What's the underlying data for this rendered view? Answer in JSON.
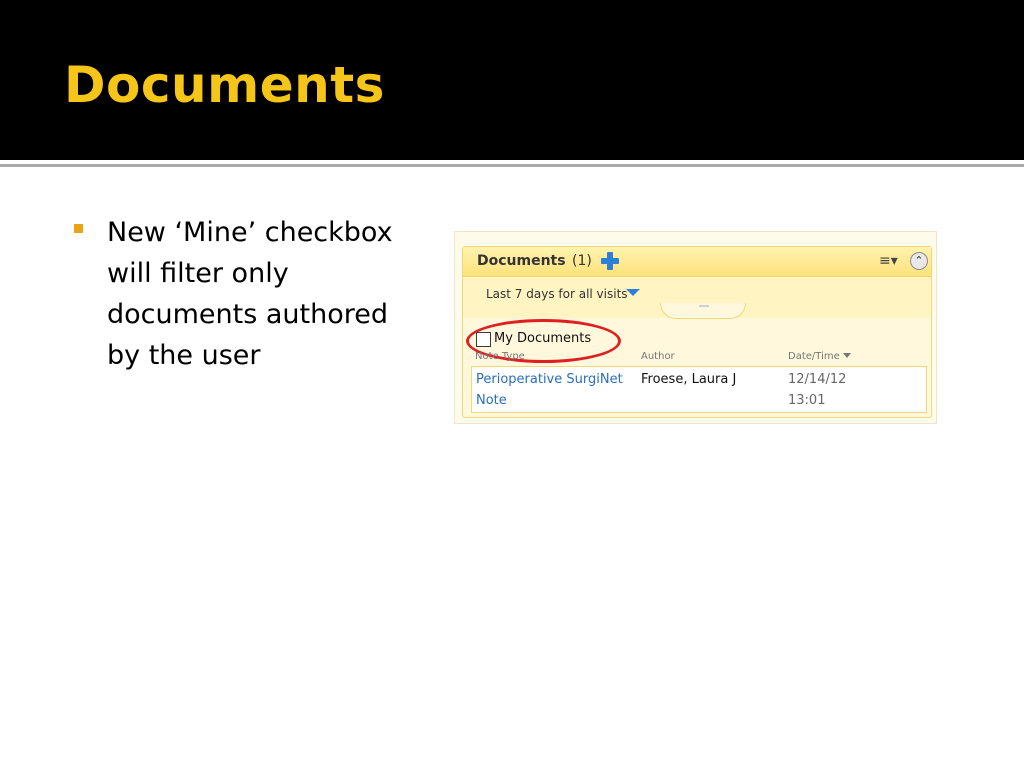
{
  "slide": {
    "title": "Documents",
    "bullet_lines": [
      "New ‘Mine’ checkbox",
      "will filter only",
      "documents authored",
      "by the user"
    ]
  },
  "colors": {
    "title_text": "#f5c518",
    "title_background": "#000000",
    "bullet_marker": "#e8a317",
    "panel_header": "#ffe27a",
    "link": "#2a6ebd",
    "highlight_oval": "#e02020"
  },
  "panel": {
    "title": "Documents",
    "count": "(1)",
    "icons": {
      "add": "plus-icon",
      "menu": "menu-icon",
      "collapse": "collapse-icon"
    },
    "menu_glyph": "≡▾",
    "collapse_glyph": "⌃",
    "filter": {
      "label": "Last 7 days for all visits",
      "caret_icon": "caret-down-icon"
    },
    "checkbox": {
      "label": "My Documents",
      "checked": false
    },
    "columns": {
      "note_type": "Note Type",
      "author": "Author",
      "date_time": "Date/Time"
    },
    "rows": [
      {
        "note_type_line1": "Perioperative SurgiNet",
        "note_type_line2": "Note",
        "author": "Froese, Laura J",
        "date": "12/14/12",
        "time": "13:01"
      }
    ]
  }
}
